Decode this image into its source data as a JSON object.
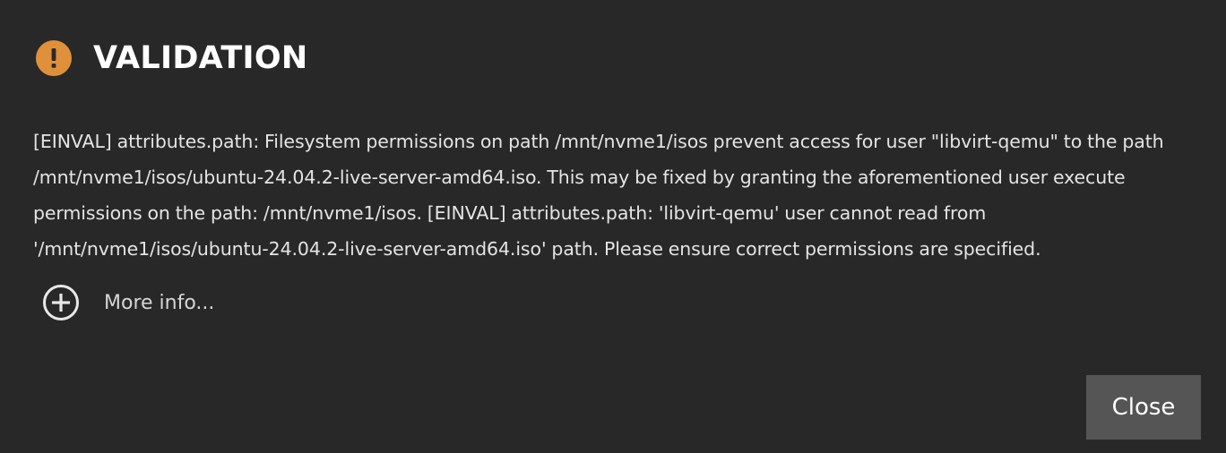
{
  "dialog": {
    "title": "VALIDATION",
    "icon": "exclamation-circle-icon",
    "accent_color": "#e0903a",
    "message": "[EINVAL] attributes.path: Filesystem permissions on path /mnt/nvme1/isos prevent access for user \"libvirt-qemu\" to the path /mnt/nvme1/isos/ubuntu-24.04.2-live-server-amd64.iso. This may be fixed by granting the aforementioned user execute permissions on the path: /mnt/nvme1/isos. [EINVAL] attributes.path: 'libvirt-qemu' user cannot read from '/mnt/nvme1/isos/ubuntu-24.04.2-live-server-amd64.iso' path. Please ensure correct permissions are specified.",
    "more_info_label": "More info...",
    "more_info_icon": "plus-circle-icon",
    "close_label": "Close"
  }
}
